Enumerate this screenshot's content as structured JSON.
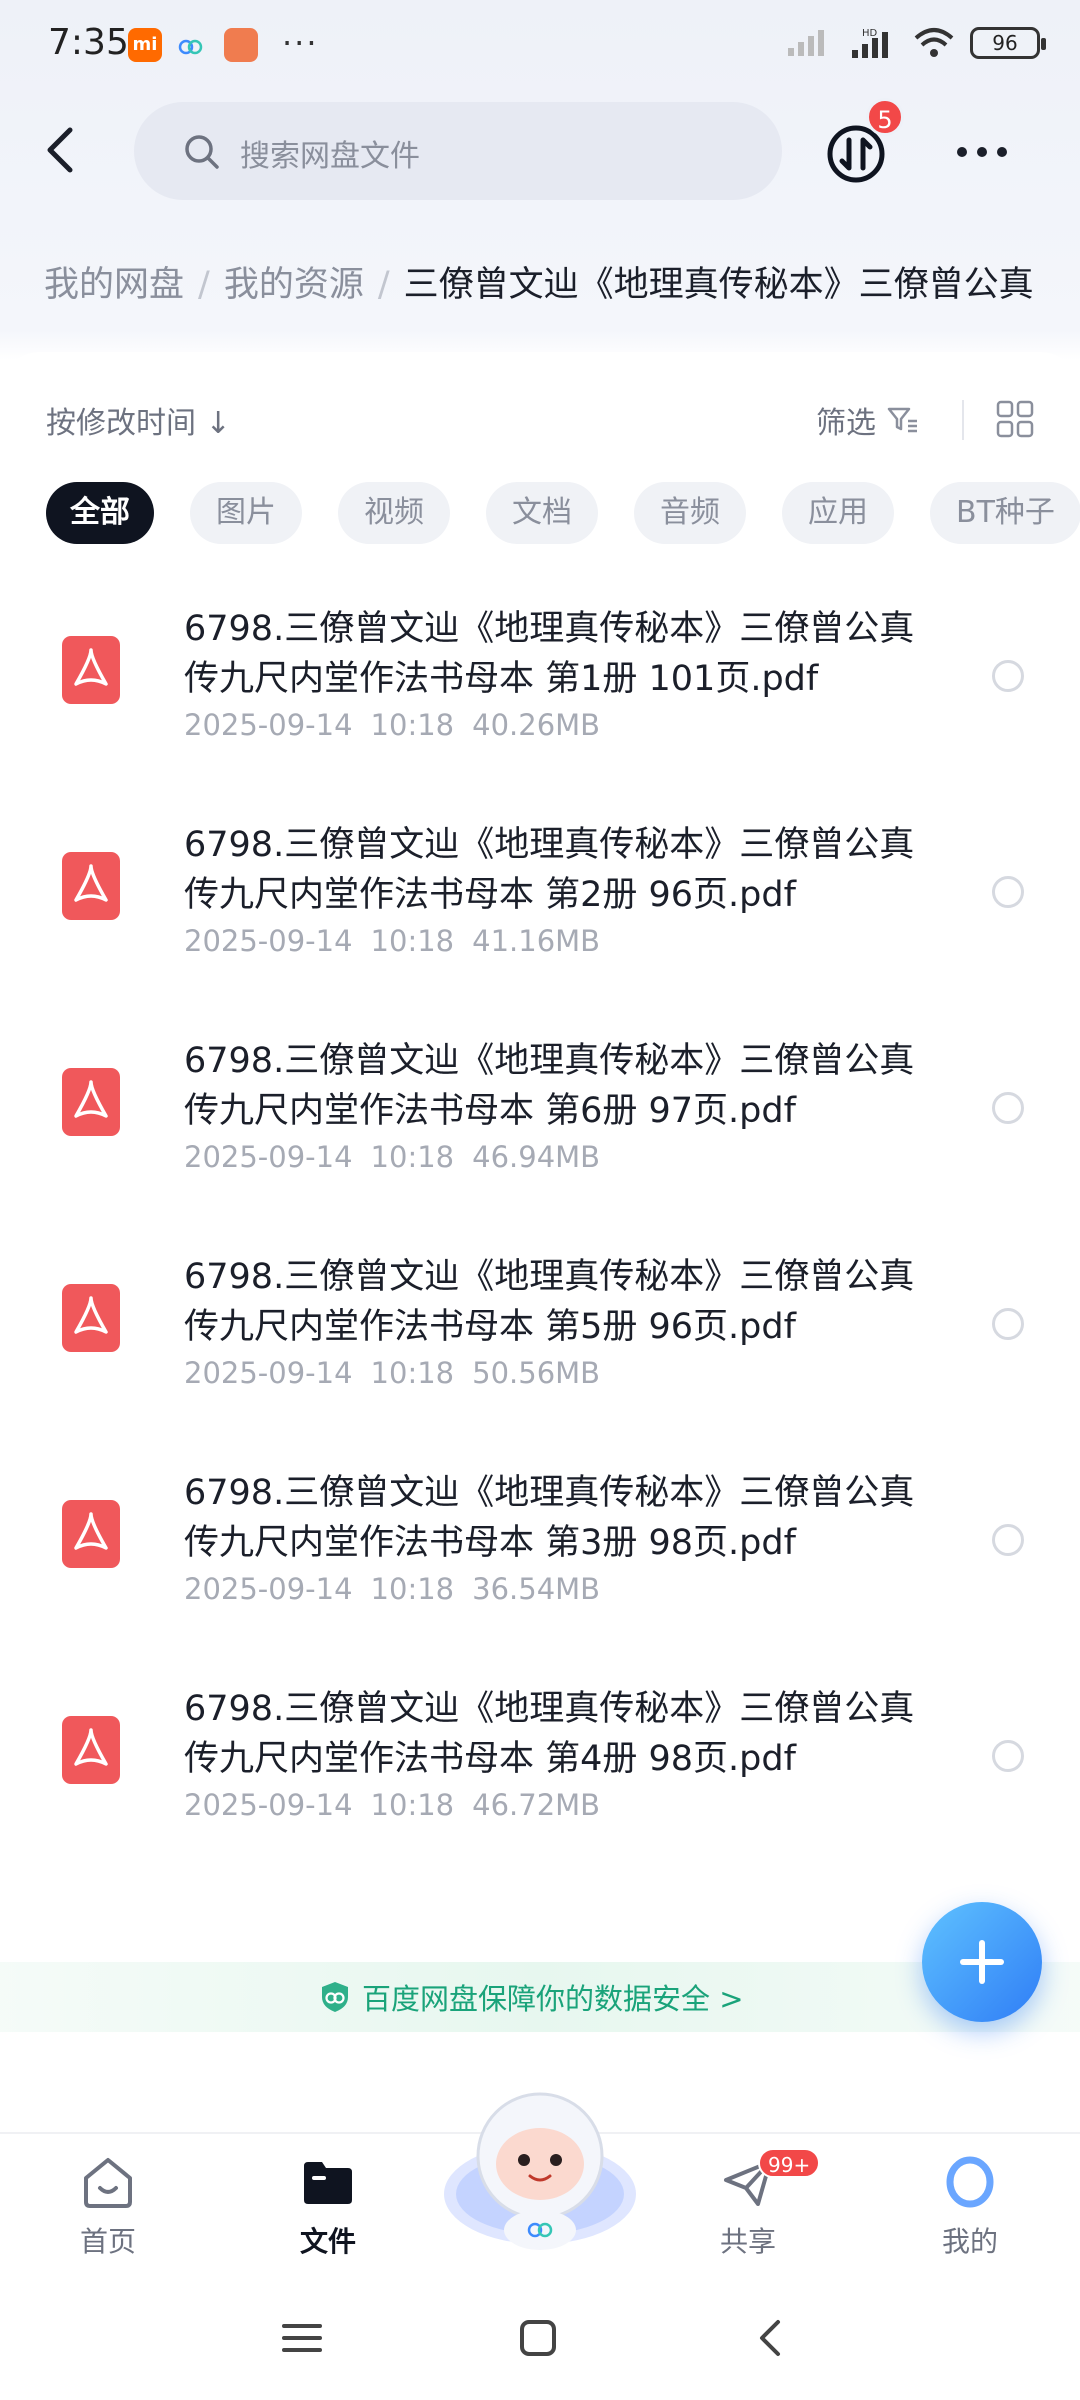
{
  "status_bar": {
    "time": "7:35",
    "mi_label": "mi",
    "more_dots": "···",
    "network": "HD",
    "battery": "96"
  },
  "header": {
    "search_placeholder": "搜索网盘文件",
    "transfer_badge": "5"
  },
  "breadcrumb": {
    "items": [
      "我的网盘",
      "我的资源"
    ],
    "current": "三僚曾文辿《地理真传秘本》三僚曾公真"
  },
  "toolbar": {
    "sort_label": "按修改时间 ↓",
    "filter_label": "筛选"
  },
  "tabs": [
    "全部",
    "图片",
    "视频",
    "文档",
    "音频",
    "应用",
    "BT种子"
  ],
  "files": [
    {
      "name": "6798.三僚曾文辿《地理真传秘本》三僚曾公真传九尺内堂作法书母本 第1册 101页.pdf",
      "date": "2025-09-14",
      "time": "10:18",
      "size": "40.26MB"
    },
    {
      "name": "6798.三僚曾文辿《地理真传秘本》三僚曾公真传九尺内堂作法书母本 第2册 96页.pdf",
      "date": "2025-09-14",
      "time": "10:18",
      "size": "41.16MB"
    },
    {
      "name": "6798.三僚曾文辿《地理真传秘本》三僚曾公真传九尺内堂作法书母本 第6册 97页.pdf",
      "date": "2025-09-14",
      "time": "10:18",
      "size": "46.94MB"
    },
    {
      "name": "6798.三僚曾文辿《地理真传秘本》三僚曾公真传九尺内堂作法书母本 第5册 96页.pdf",
      "date": "2025-09-14",
      "time": "10:18",
      "size": "50.56MB"
    },
    {
      "name": "6798.三僚曾文辿《地理真传秘本》三僚曾公真传九尺内堂作法书母本 第3册 98页.pdf",
      "date": "2025-09-14",
      "time": "10:18",
      "size": "36.54MB"
    },
    {
      "name": "6798.三僚曾文辿《地理真传秘本》三僚曾公真传九尺内堂作法书母本 第4册 98页.pdf",
      "date": "2025-09-14",
      "time": "10:18",
      "size": "46.72MB"
    }
  ],
  "security_text": "百度网盘保障你的数据安全 >",
  "bottom_nav": {
    "home": "首页",
    "files": "文件",
    "share": "共享",
    "share_badge": "99+",
    "me": "我的"
  },
  "colors": {
    "accent": "#2f7df6",
    "badge": "#f24848",
    "pdf": "#f0585b",
    "security": "#1aa37a"
  }
}
